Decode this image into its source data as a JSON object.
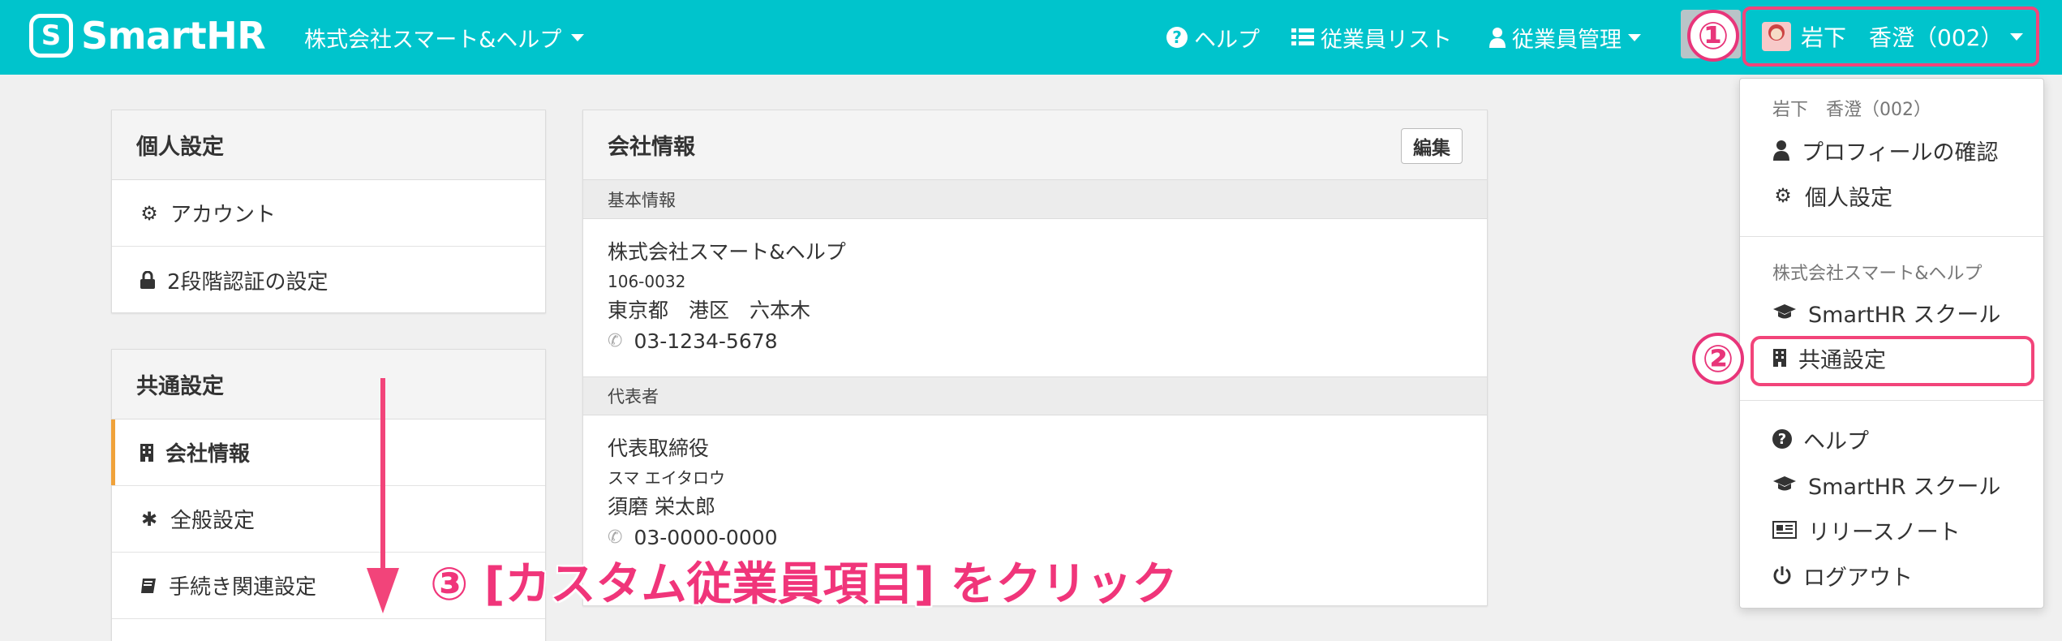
{
  "header": {
    "logo_text": "SmartHR",
    "company": "株式会社スマート&ヘルプ",
    "nav": {
      "help": "ヘルプ",
      "employee_list": "従業員リスト",
      "employee_manage": "従業員管理"
    },
    "user": "岩下　香澄（002）"
  },
  "sidebar": {
    "personal": {
      "title": "個人設定",
      "items": [
        {
          "label": "アカウント",
          "icon": "gear-icon"
        },
        {
          "label": "2段階認証の設定",
          "icon": "lock-icon"
        }
      ]
    },
    "common": {
      "title": "共通設定",
      "items": [
        {
          "label": "会社情報",
          "icon": "building-icon",
          "active": true
        },
        {
          "label": "全般設定",
          "icon": "asterisk-icon"
        },
        {
          "label": "手続き関連設定",
          "icon": "book-icon"
        }
      ]
    }
  },
  "company_info": {
    "title": "会社情報",
    "edit_label": "編集",
    "basic": {
      "section_title": "基本情報",
      "name": "株式会社スマート&ヘルプ",
      "postal": "106-0032",
      "address": "東京都　港区　六本木",
      "phone": "03-1234-5678"
    },
    "representative": {
      "section_title": "代表者",
      "position": "代表取締役",
      "kana": "スマ エイタロウ",
      "name": "須磨 栄太郎",
      "phone": "03-0000-0000"
    }
  },
  "dropdown": {
    "user_header": "岩下　香澄（002）",
    "user_items": [
      {
        "label": "プロフィールの確認",
        "icon": "person-icon"
      },
      {
        "label": "個人設定",
        "icon": "gear-icon"
      }
    ],
    "company_header": "株式会社スマート&ヘルプ",
    "company_items": [
      {
        "label": "SmartHR スクール",
        "icon": "graduation-cap-icon"
      },
      {
        "label": "共通設定",
        "icon": "building-icon"
      }
    ],
    "general_items": [
      {
        "label": "ヘルプ",
        "icon": "help-icon"
      },
      {
        "label": "SmartHR スクール",
        "icon": "graduation-cap-icon"
      },
      {
        "label": "リリースノート",
        "icon": "newspaper-icon"
      },
      {
        "label": "ログアウト",
        "icon": "power-icon"
      }
    ]
  },
  "annotations": {
    "marker1": "①",
    "marker2": "②",
    "instruction": "③ [カスタム従業員項目] をクリック"
  },
  "colors": {
    "brand": "#00c4cc",
    "annotation": "#f2447a",
    "active_indicator": "#f0a23a"
  }
}
